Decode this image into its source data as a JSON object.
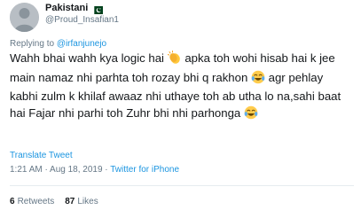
{
  "tweet": {
    "display_name": "Pakistani",
    "handle": "@Proud_Insafian1",
    "replying_prefix": "Replying to",
    "replying_to": "@irfanjunejo",
    "text_parts": [
      "Wahh bhai wahh kya logic hai ",
      " apka toh wohi hisab hai k jee main namaz nhi parhta toh rozay bhi q rakhon ",
      " agr pehlay kabhi zulm k khilaf awaaz nhi uthaye toh ab utha lo na,sahi baat hai Fajar nhi parhi toh Zuhr bhi nhi parhonga "
    ],
    "translate_label": "Translate Tweet",
    "timestamp": "1:21 AM · Aug 18, 2019 · ",
    "source": "Twitter for iPhone",
    "retweets_count": "6",
    "retweets_label": "Retweets",
    "likes_count": "87",
    "likes_label": "Likes",
    "flag_icon": "pakistan-flag-icon",
    "emoji_icons": [
      "clapping-hands-icon",
      "tears-of-joy-icon",
      "tears-of-joy-icon"
    ],
    "colors": {
      "link": "#1b95e0",
      "muted": "#657786",
      "text": "#14171a"
    }
  }
}
